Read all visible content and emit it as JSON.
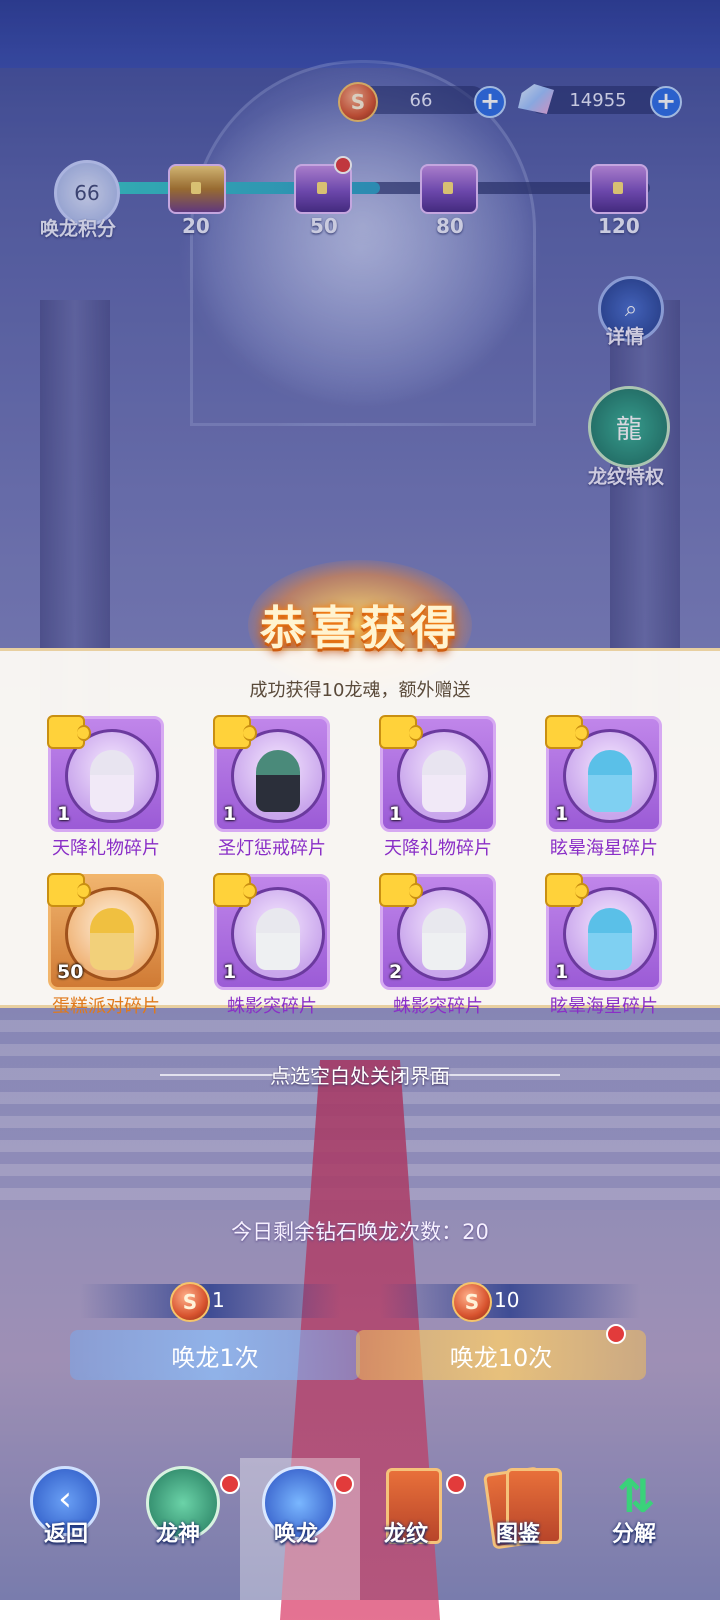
{
  "currency": {
    "coins": "66",
    "gems": "14955",
    "coin_symbol": "S",
    "plus": "+"
  },
  "progress": {
    "score": "66",
    "label": "唤龙积分",
    "fill_fraction": 0.5,
    "milestones": [
      "20",
      "50",
      "80",
      "120"
    ]
  },
  "side": {
    "details": "详情",
    "dragon_pattern_privilege": "龙纹特权"
  },
  "reward": {
    "title": "恭喜获得",
    "subtitle": "成功获得10龙魂，额外赠送",
    "items": [
      {
        "count": "1",
        "name": "天降礼物碎片"
      },
      {
        "count": "1",
        "name": "圣灯惩戒碎片"
      },
      {
        "count": "1",
        "name": "天降礼物碎片"
      },
      {
        "count": "1",
        "name": "眩晕海星碎片"
      },
      {
        "count": "50",
        "name": "蛋糕派对碎片"
      },
      {
        "count": "1",
        "name": "蛛影突碎片"
      },
      {
        "count": "2",
        "name": "蛛影突碎片"
      },
      {
        "count": "1",
        "name": "眩晕海星碎片"
      }
    ],
    "close_hint": "点选空白处关闭界面"
  },
  "summon": {
    "remaining": "今日剩余钻石唤龙次数：20",
    "cost_one": "1",
    "cost_ten": "10",
    "summon_one": "唤龙1次",
    "summon_ten": "唤龙10次"
  },
  "nav": {
    "back": "返回",
    "dragon_god": "龙神",
    "summon": "唤龙",
    "pattern": "龙纹",
    "codex": "图鉴",
    "decompose": "分解"
  },
  "colors": {
    "accent_purple": "#9b5bd6",
    "accent_orange": "#d07a34",
    "badge_red": "#e23b3b",
    "blue_button": "#2d6ee8"
  }
}
